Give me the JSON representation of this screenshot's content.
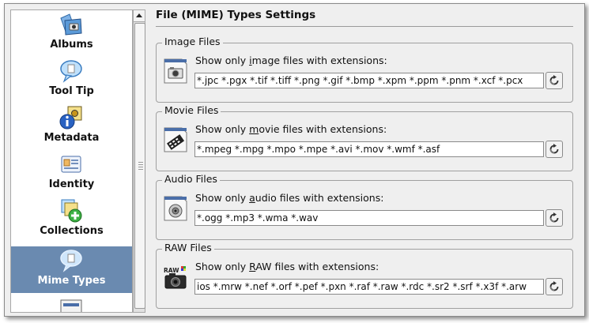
{
  "sidebar": {
    "items": [
      {
        "label": "Albums",
        "icon": "albums-icon"
      },
      {
        "label": "Tool Tip",
        "icon": "tooltip-icon"
      },
      {
        "label": "Metadata",
        "icon": "metadata-icon"
      },
      {
        "label": "Identity",
        "icon": "identity-icon"
      },
      {
        "label": "Collections",
        "icon": "collections-icon"
      },
      {
        "label": "Mime Types",
        "icon": "mime-types-icon",
        "selected": true
      }
    ],
    "selected_color": "#6a8ab0"
  },
  "page": {
    "title": "File (MIME) Types Settings"
  },
  "groups": {
    "image": {
      "title": "Image Files",
      "desc_pre": "Show only ",
      "desc_accel": "i",
      "desc_post": "mage files with extensions:",
      "value": "*.jpc *.pgx *.tif *.tiff *.png *.gif *.bmp *.xpm *.ppm *.pnm *.xcf *.pcx"
    },
    "movie": {
      "title": "Movie Files",
      "desc_pre": "Show only ",
      "desc_accel": "m",
      "desc_post": "ovie files with extensions:",
      "value": "*.mpeg *.mpg *.mpo *.mpe *.avi *.mov *.wmf *.asf"
    },
    "audio": {
      "title": "Audio Files",
      "desc_pre": "Show only ",
      "desc_accel": "a",
      "desc_post": "udio files with extensions:",
      "value": "*.ogg *.mp3 *.wma *.wav"
    },
    "raw": {
      "title": "RAW Files",
      "desc_pre": "Show only ",
      "desc_accel": "R",
      "desc_post": "AW files with extensions:",
      "value": "ios *.mrw *.nef *.orf *.pef *.pxn *.raf *.raw *.rdc *.sr2 *.srf *.x3f *.arw",
      "icon_text": "RAW"
    }
  }
}
